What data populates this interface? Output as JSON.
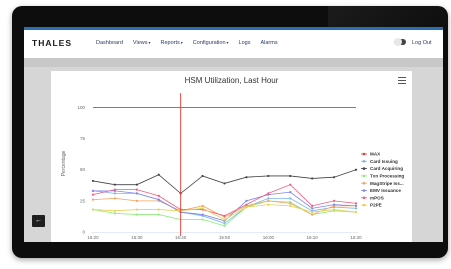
{
  "header": {
    "brand": "THALES",
    "menu": [
      {
        "label": "Dashboard",
        "caret": false
      },
      {
        "label": "Views",
        "caret": true
      },
      {
        "label": "Reports",
        "caret": true
      },
      {
        "label": "Configuration",
        "caret": true
      },
      {
        "label": "Logs",
        "caret": false
      },
      {
        "label": "Alarms",
        "caret": false
      }
    ],
    "logout": "Log Out",
    "caret_glyph": "▾"
  },
  "chart_data": {
    "type": "line",
    "title": "HSM Utilization, Last Hour",
    "ylabel": "Percentage",
    "xlabel": "",
    "ylim": [
      0,
      110
    ],
    "yticks": [
      0,
      25,
      50,
      75,
      100
    ],
    "x": [
      "15:20",
      "15:25",
      "15:30",
      "15:35",
      "15:40",
      "15:45",
      "15:50",
      "15:55",
      "16:00",
      "16:05",
      "16:10",
      "16:15",
      "16:20"
    ],
    "xtick_labels": [
      "15:20",
      "15:30",
      "15:40",
      "15:50",
      "16:00",
      "16:10",
      "16:20"
    ],
    "marker_x": "15:40",
    "legend_position": "right",
    "series": [
      {
        "name": "MAX",
        "color": "#e53935",
        "values": [
          100,
          100,
          100,
          100,
          100,
          100,
          100,
          100,
          100,
          100,
          100,
          100,
          100
        ]
      },
      {
        "name": "Card Issuing",
        "color": "#7cb5ec",
        "values": [
          33,
          31,
          31,
          26,
          16,
          13,
          7,
          20,
          27,
          27,
          17,
          20,
          19
        ]
      },
      {
        "name": "Card Acquiring",
        "color": "#434348",
        "values": [
          41,
          38,
          38,
          46,
          31,
          45,
          39,
          44,
          45,
          45,
          43,
          44,
          50
        ]
      },
      {
        "name": "Txn Processing",
        "color": "#90ed7d",
        "values": [
          18,
          15,
          14,
          14,
          10,
          10,
          5,
          20,
          25,
          24,
          14,
          17,
          16
        ]
      },
      {
        "name": "MagStripe Iss...",
        "color": "#f7a35c",
        "values": [
          26,
          27,
          25,
          25,
          17,
          21,
          12,
          21,
          25,
          23,
          14,
          21,
          21
        ]
      },
      {
        "name": "EMV Issuance",
        "color": "#8085e9",
        "values": [
          33,
          33,
          31,
          26,
          16,
          14,
          9,
          25,
          30,
          32,
          19,
          22,
          21
        ]
      },
      {
        "name": "mPOS",
        "color": "#f15c80",
        "values": [
          30,
          34,
          34,
          29,
          18,
          18,
          13,
          22,
          31,
          38,
          21,
          25,
          23
        ]
      },
      {
        "name": "P2PE",
        "color": "#e4d354",
        "values": [
          18,
          17,
          18,
          18,
          17,
          19,
          10,
          20,
          22,
          21,
          16,
          18,
          16
        ]
      }
    ]
  }
}
